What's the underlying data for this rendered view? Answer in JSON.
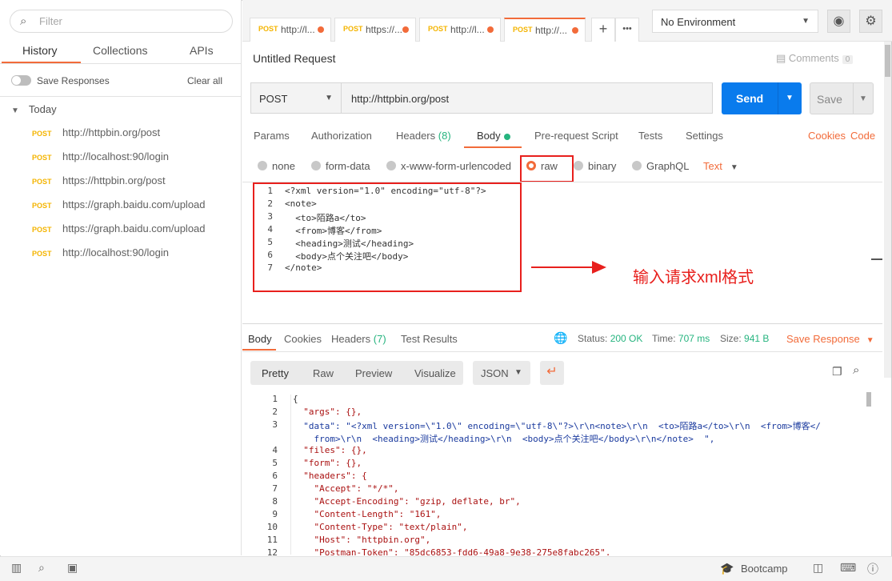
{
  "sidebar": {
    "filter_placeholder": "Filter",
    "tabs": [
      "History",
      "Collections",
      "APIs"
    ],
    "save_responses": "Save Responses",
    "clear_all": "Clear all",
    "group": "Today",
    "history": [
      {
        "method": "POST",
        "url": "http://httpbin.org/post"
      },
      {
        "method": "POST",
        "url": "http://localhost:90/login"
      },
      {
        "method": "POST",
        "url": "https://httpbin.org/post"
      },
      {
        "method": "POST",
        "url": "https://graph.baidu.com/upload"
      },
      {
        "method": "POST",
        "url": "https://graph.baidu.com/upload"
      },
      {
        "method": "POST",
        "url": "http://localhost:90/login"
      }
    ]
  },
  "tabs": [
    {
      "method": "POST",
      "url": "http://l..."
    },
    {
      "method": "POST",
      "url": "https://..."
    },
    {
      "method": "POST",
      "url": "http://l..."
    },
    {
      "method": "POST",
      "url": "http://..."
    }
  ],
  "tab_actions": {
    "add": "+",
    "more": "•••"
  },
  "environment": {
    "selected": "No Environment"
  },
  "request": {
    "title": "Untitled Request",
    "comments_label": "Comments",
    "comments_count": "0",
    "method": "POST",
    "url": "http://httpbin.org/post",
    "send": "Send",
    "save": "Save"
  },
  "request_tabs": {
    "params": "Params",
    "authorization": "Authorization",
    "headers": "Headers",
    "headers_count": "(8)",
    "body": "Body",
    "prerequest": "Pre-request Script",
    "tests": "Tests",
    "settings": "Settings",
    "cookies": "Cookies",
    "code": "Code"
  },
  "body_types": {
    "none": "none",
    "form_data": "form-data",
    "urlencoded": "x-www-form-urlencoded",
    "raw": "raw",
    "binary": "binary",
    "graphql": "GraphQL",
    "text": "Text"
  },
  "editor_lines": [
    "<?xml version=\"1.0\" encoding=\"utf-8\"?>",
    "<note>",
    "  <to>陌路a</to>",
    "  <from>博客</from>",
    "  <heading>测试</heading>",
    "  <body>点个关注吧</body>",
    "</note>"
  ],
  "annotation": "输入请求xml格式",
  "response": {
    "tabs": {
      "body": "Body",
      "cookies": "Cookies",
      "headers": "Headers",
      "headers_count": "(7)",
      "tests": "Test Results"
    },
    "status_label": "Status:",
    "status": "200 OK",
    "time_label": "Time:",
    "time": "707 ms",
    "size_label": "Size:",
    "size": "941 B",
    "save_response": "Save Response",
    "views": {
      "pretty": "Pretty",
      "raw": "Raw",
      "preview": "Preview",
      "visualize": "Visualize"
    },
    "format": "JSON"
  },
  "response_lines": [
    "{",
    "  \"args\": {},",
    "  \"data\": \"<?xml version=\\\"1.0\\\" encoding=\\\"utf-8\\\"?>\\r\\n<note>\\r\\n  <to>陌路a</to>\\r\\n  <from>博客</",
    "    from>\\r\\n  <heading>测试</heading>\\r\\n  <body>点个关注吧</body>\\r\\n</note>  \",",
    "  \"files\": {},",
    "  \"form\": {},",
    "  \"headers\": {",
    "    \"Accept\": \"*/*\",",
    "    \"Accept-Encoding\": \"gzip, deflate, br\",",
    "    \"Content-Length\": \"161\",",
    "    \"Content-Type\": \"text/plain\",",
    "    \"Host\": \"httpbin.org\",",
    "    \"Postman-Token\": \"85dc6853-fdd6-49a8-9e38-275e8fabc265\","
  ],
  "response_line_numbers": [
    "1",
    "2",
    "3",
    "",
    "4",
    "5",
    "6",
    "7",
    "8",
    "9",
    "10",
    "11",
    "12"
  ],
  "footer": {
    "bootcamp": "Bootcamp"
  }
}
